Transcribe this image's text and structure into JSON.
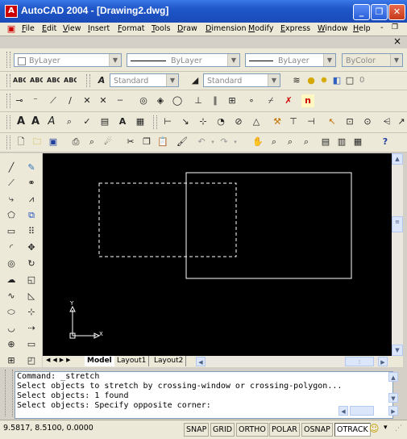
{
  "window": {
    "title": "AutoCAD 2004 - [Drawing2.dwg]",
    "app_icon_glyph": "A",
    "controls": {
      "minimize": "_",
      "restore": "❐",
      "close": "✕"
    }
  },
  "menubar": {
    "items": [
      "File",
      "Edit",
      "View",
      "Insert",
      "Format",
      "Tools",
      "Draw",
      "Dimension",
      "Modify",
      "Express",
      "Window",
      "Help"
    ],
    "doc_controls": {
      "minimize": "-",
      "restore": "❐",
      "close": "×"
    }
  },
  "properties_toolbar": {
    "layer_combo": "ByLayer",
    "linetype_combo": "ByLayer",
    "lineweight_combo": "ByLayer",
    "color_combo": "ByColor"
  },
  "styles_toolbar": {
    "text_style": "Standard",
    "dim_style": "Standard",
    "layer_value": "0"
  },
  "drawing": {
    "background": "#000000",
    "selection_window_color": "#ffffff",
    "rectangle_color": "#ffffff",
    "ucs_x_label": "X",
    "ucs_y_label": "Y"
  },
  "layout_tabs": [
    "Model",
    "Layout1",
    "Layout2"
  ],
  "command_window": {
    "lines": [
      "Command: _stretch",
      "Select objects to stretch by crossing-window or crossing-polygon...",
      "Select objects: 1 found",
      "Select objects: Specify opposite corner:"
    ]
  },
  "statusbar": {
    "coordinates": "9.5817, 8.5100, 0.0000",
    "toggles": [
      "SNAP",
      "GRID",
      "ORTHO",
      "POLAR",
      "OSNAP",
      "OTRACK"
    ],
    "active_toggle": "OTRACK"
  }
}
